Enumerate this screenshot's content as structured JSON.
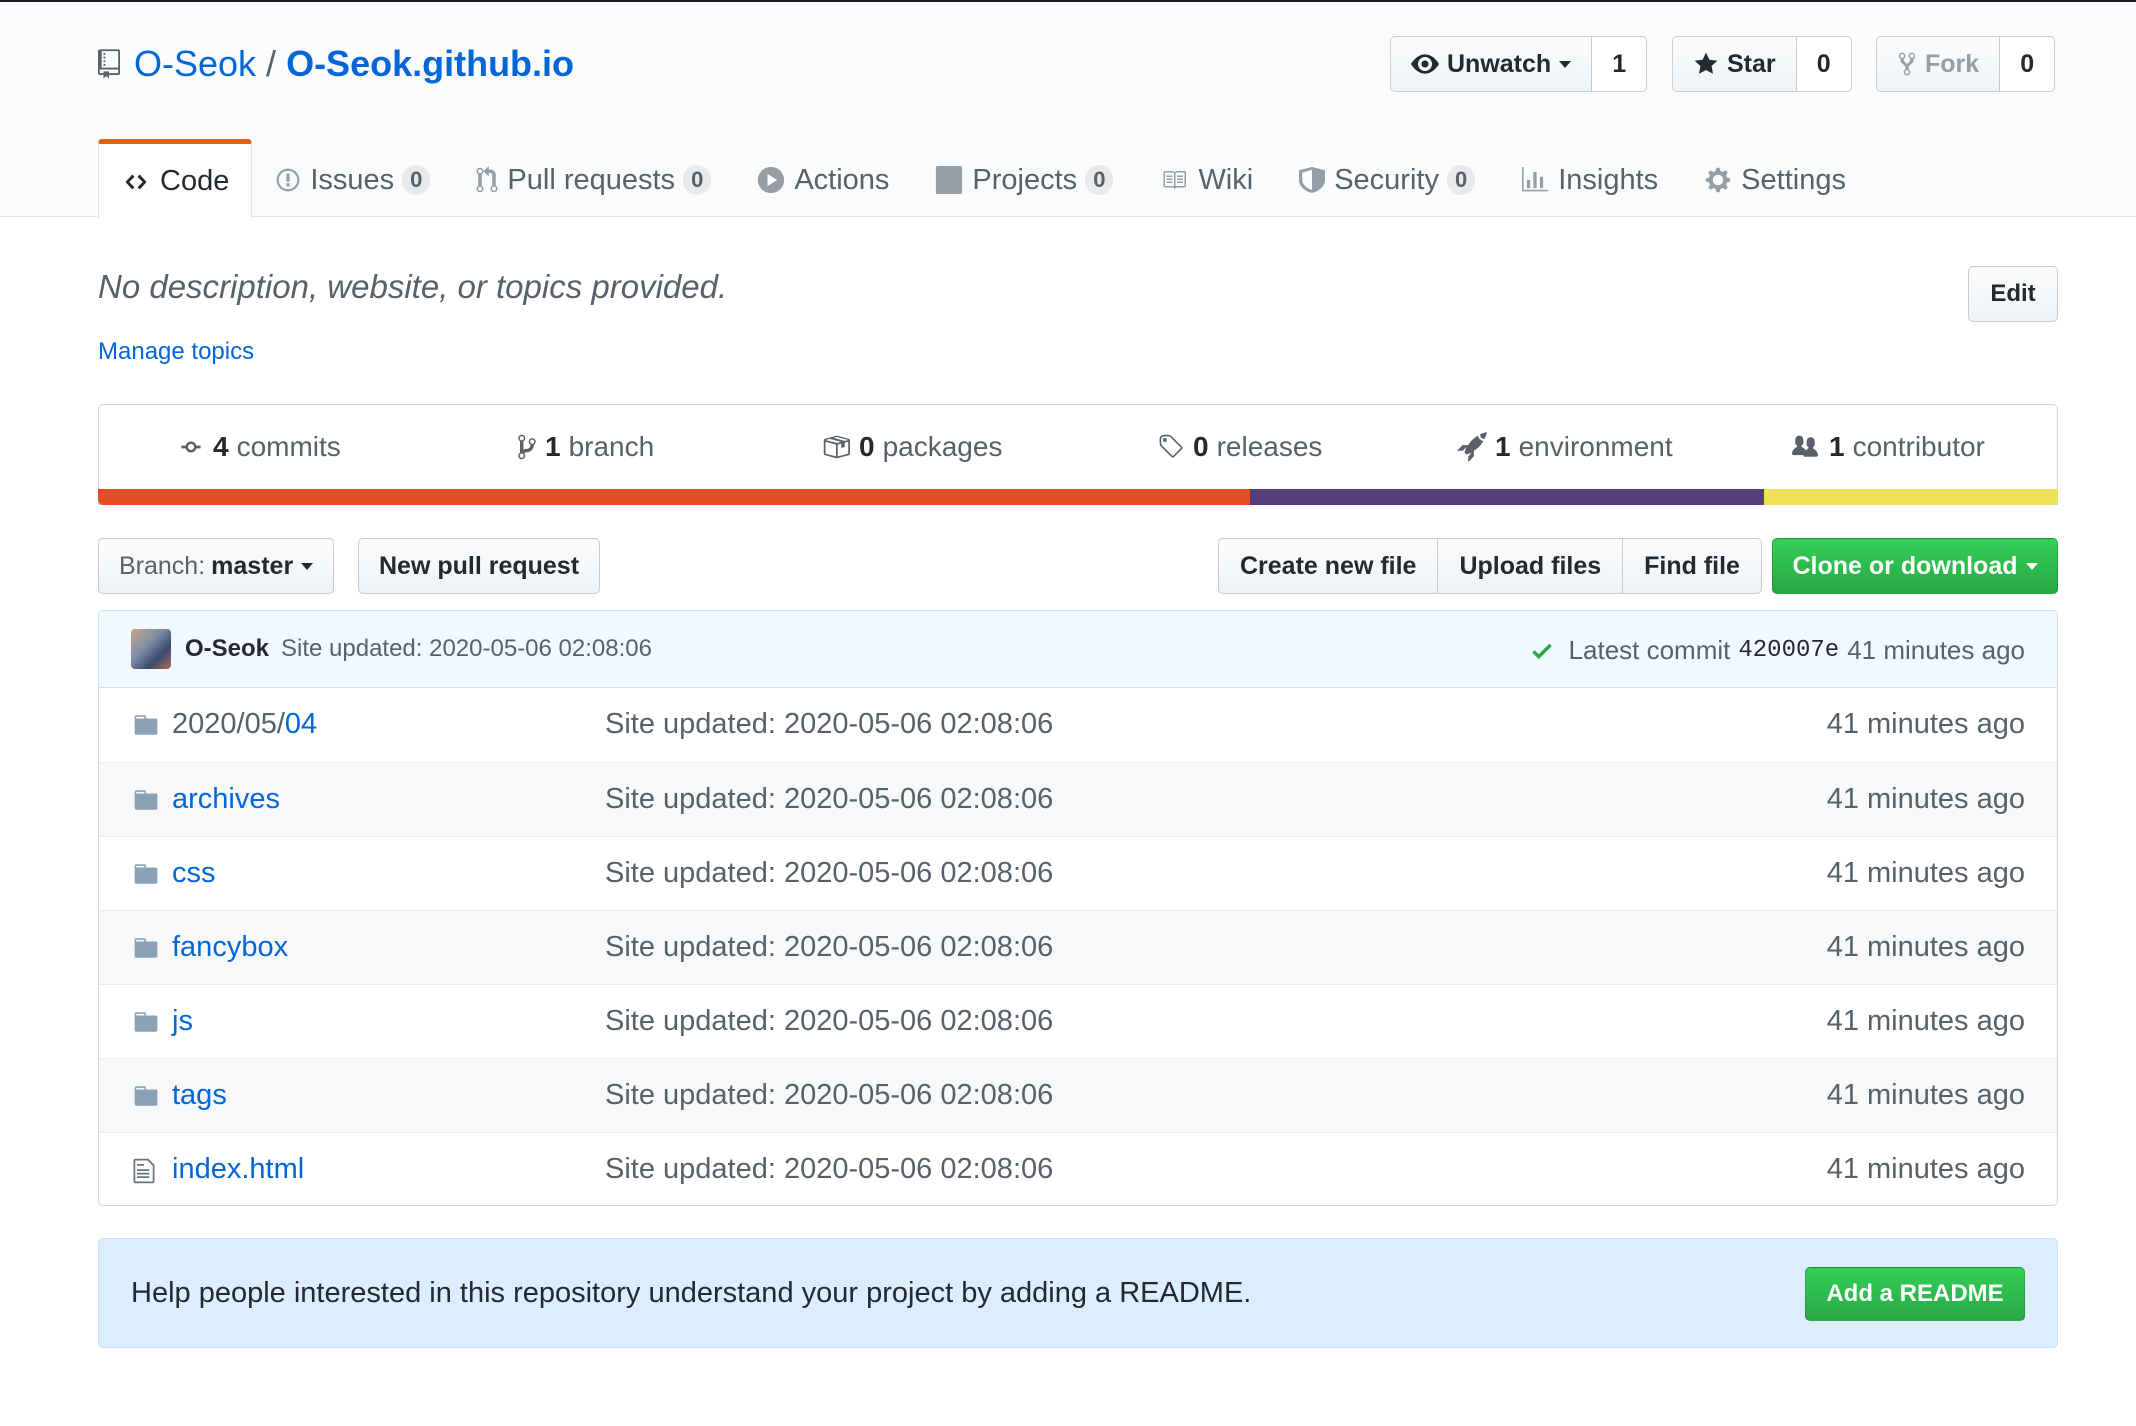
{
  "repo": {
    "owner": "O-Seok",
    "separator": "/",
    "name": "O-Seok.github.io"
  },
  "actions": {
    "watch": {
      "label": "Unwatch",
      "count": "1"
    },
    "star": {
      "label": "Star",
      "count": "0"
    },
    "fork": {
      "label": "Fork",
      "count": "0"
    }
  },
  "tabs": [
    {
      "label": "Code",
      "icon": "code-icon",
      "count": null
    },
    {
      "label": "Issues",
      "icon": "issue-icon",
      "count": "0"
    },
    {
      "label": "Pull requests",
      "icon": "pull-request-icon",
      "count": "0"
    },
    {
      "label": "Actions",
      "icon": "play-icon",
      "count": null
    },
    {
      "label": "Projects",
      "icon": "project-icon",
      "count": "0"
    },
    {
      "label": "Wiki",
      "icon": "book-icon",
      "count": null
    },
    {
      "label": "Security",
      "icon": "shield-icon",
      "count": "0"
    },
    {
      "label": "Insights",
      "icon": "graph-icon",
      "count": null
    },
    {
      "label": "Settings",
      "icon": "gear-icon",
      "count": null
    }
  ],
  "description": {
    "text": "No description, website, or topics provided.",
    "manage_topics": "Manage topics",
    "edit_label": "Edit"
  },
  "stats": [
    {
      "num": "4",
      "label": "commits",
      "icon": "commit-icon"
    },
    {
      "num": "1",
      "label": "branch",
      "icon": "branch-icon"
    },
    {
      "num": "0",
      "label": "packages",
      "icon": "package-icon"
    },
    {
      "num": "0",
      "label": "releases",
      "icon": "tag-icon"
    },
    {
      "num": "1",
      "label": "environment",
      "icon": "rocket-icon"
    },
    {
      "num": "1",
      "label": "contributor",
      "icon": "people-icon"
    }
  ],
  "language_bar": [
    {
      "color": "#e34c26",
      "fraction": 0.588
    },
    {
      "color": "#563d7c",
      "fraction": 0.262
    },
    {
      "color": "#f1e05a",
      "fraction": 0.15
    }
  ],
  "toolbar": {
    "branch_label": "Branch:",
    "branch_value": "master",
    "new_pr": "New pull request",
    "create_file": "Create new file",
    "upload_files": "Upload files",
    "find_file": "Find file",
    "clone": "Clone or download"
  },
  "latest_commit": {
    "author": "O-Seok",
    "message": "Site updated: 2020-05-06 02:08:06",
    "prefix": "Latest commit",
    "sha": "420007e",
    "age": "41 minutes ago"
  },
  "files": [
    {
      "type": "dir",
      "prefix": "2020/05/",
      "name": "04",
      "message": "Site updated: 2020-05-06 02:08:06",
      "age": "41 minutes ago"
    },
    {
      "type": "dir",
      "prefix": "",
      "name": "archives",
      "message": "Site updated: 2020-05-06 02:08:06",
      "age": "41 minutes ago"
    },
    {
      "type": "dir",
      "prefix": "",
      "name": "css",
      "message": "Site updated: 2020-05-06 02:08:06",
      "age": "41 minutes ago"
    },
    {
      "type": "dir",
      "prefix": "",
      "name": "fancybox",
      "message": "Site updated: 2020-05-06 02:08:06",
      "age": "41 minutes ago"
    },
    {
      "type": "dir",
      "prefix": "",
      "name": "js",
      "message": "Site updated: 2020-05-06 02:08:06",
      "age": "41 minutes ago"
    },
    {
      "type": "dir",
      "prefix": "",
      "name": "tags",
      "message": "Site updated: 2020-05-06 02:08:06",
      "age": "41 minutes ago"
    },
    {
      "type": "file",
      "prefix": "",
      "name": "index.html",
      "message": "Site updated: 2020-05-06 02:08:06",
      "age": "41 minutes ago"
    }
  ],
  "readme_prompt": {
    "text": "Help people interested in this repository understand your project by adding a README.",
    "button": "Add a README"
  }
}
